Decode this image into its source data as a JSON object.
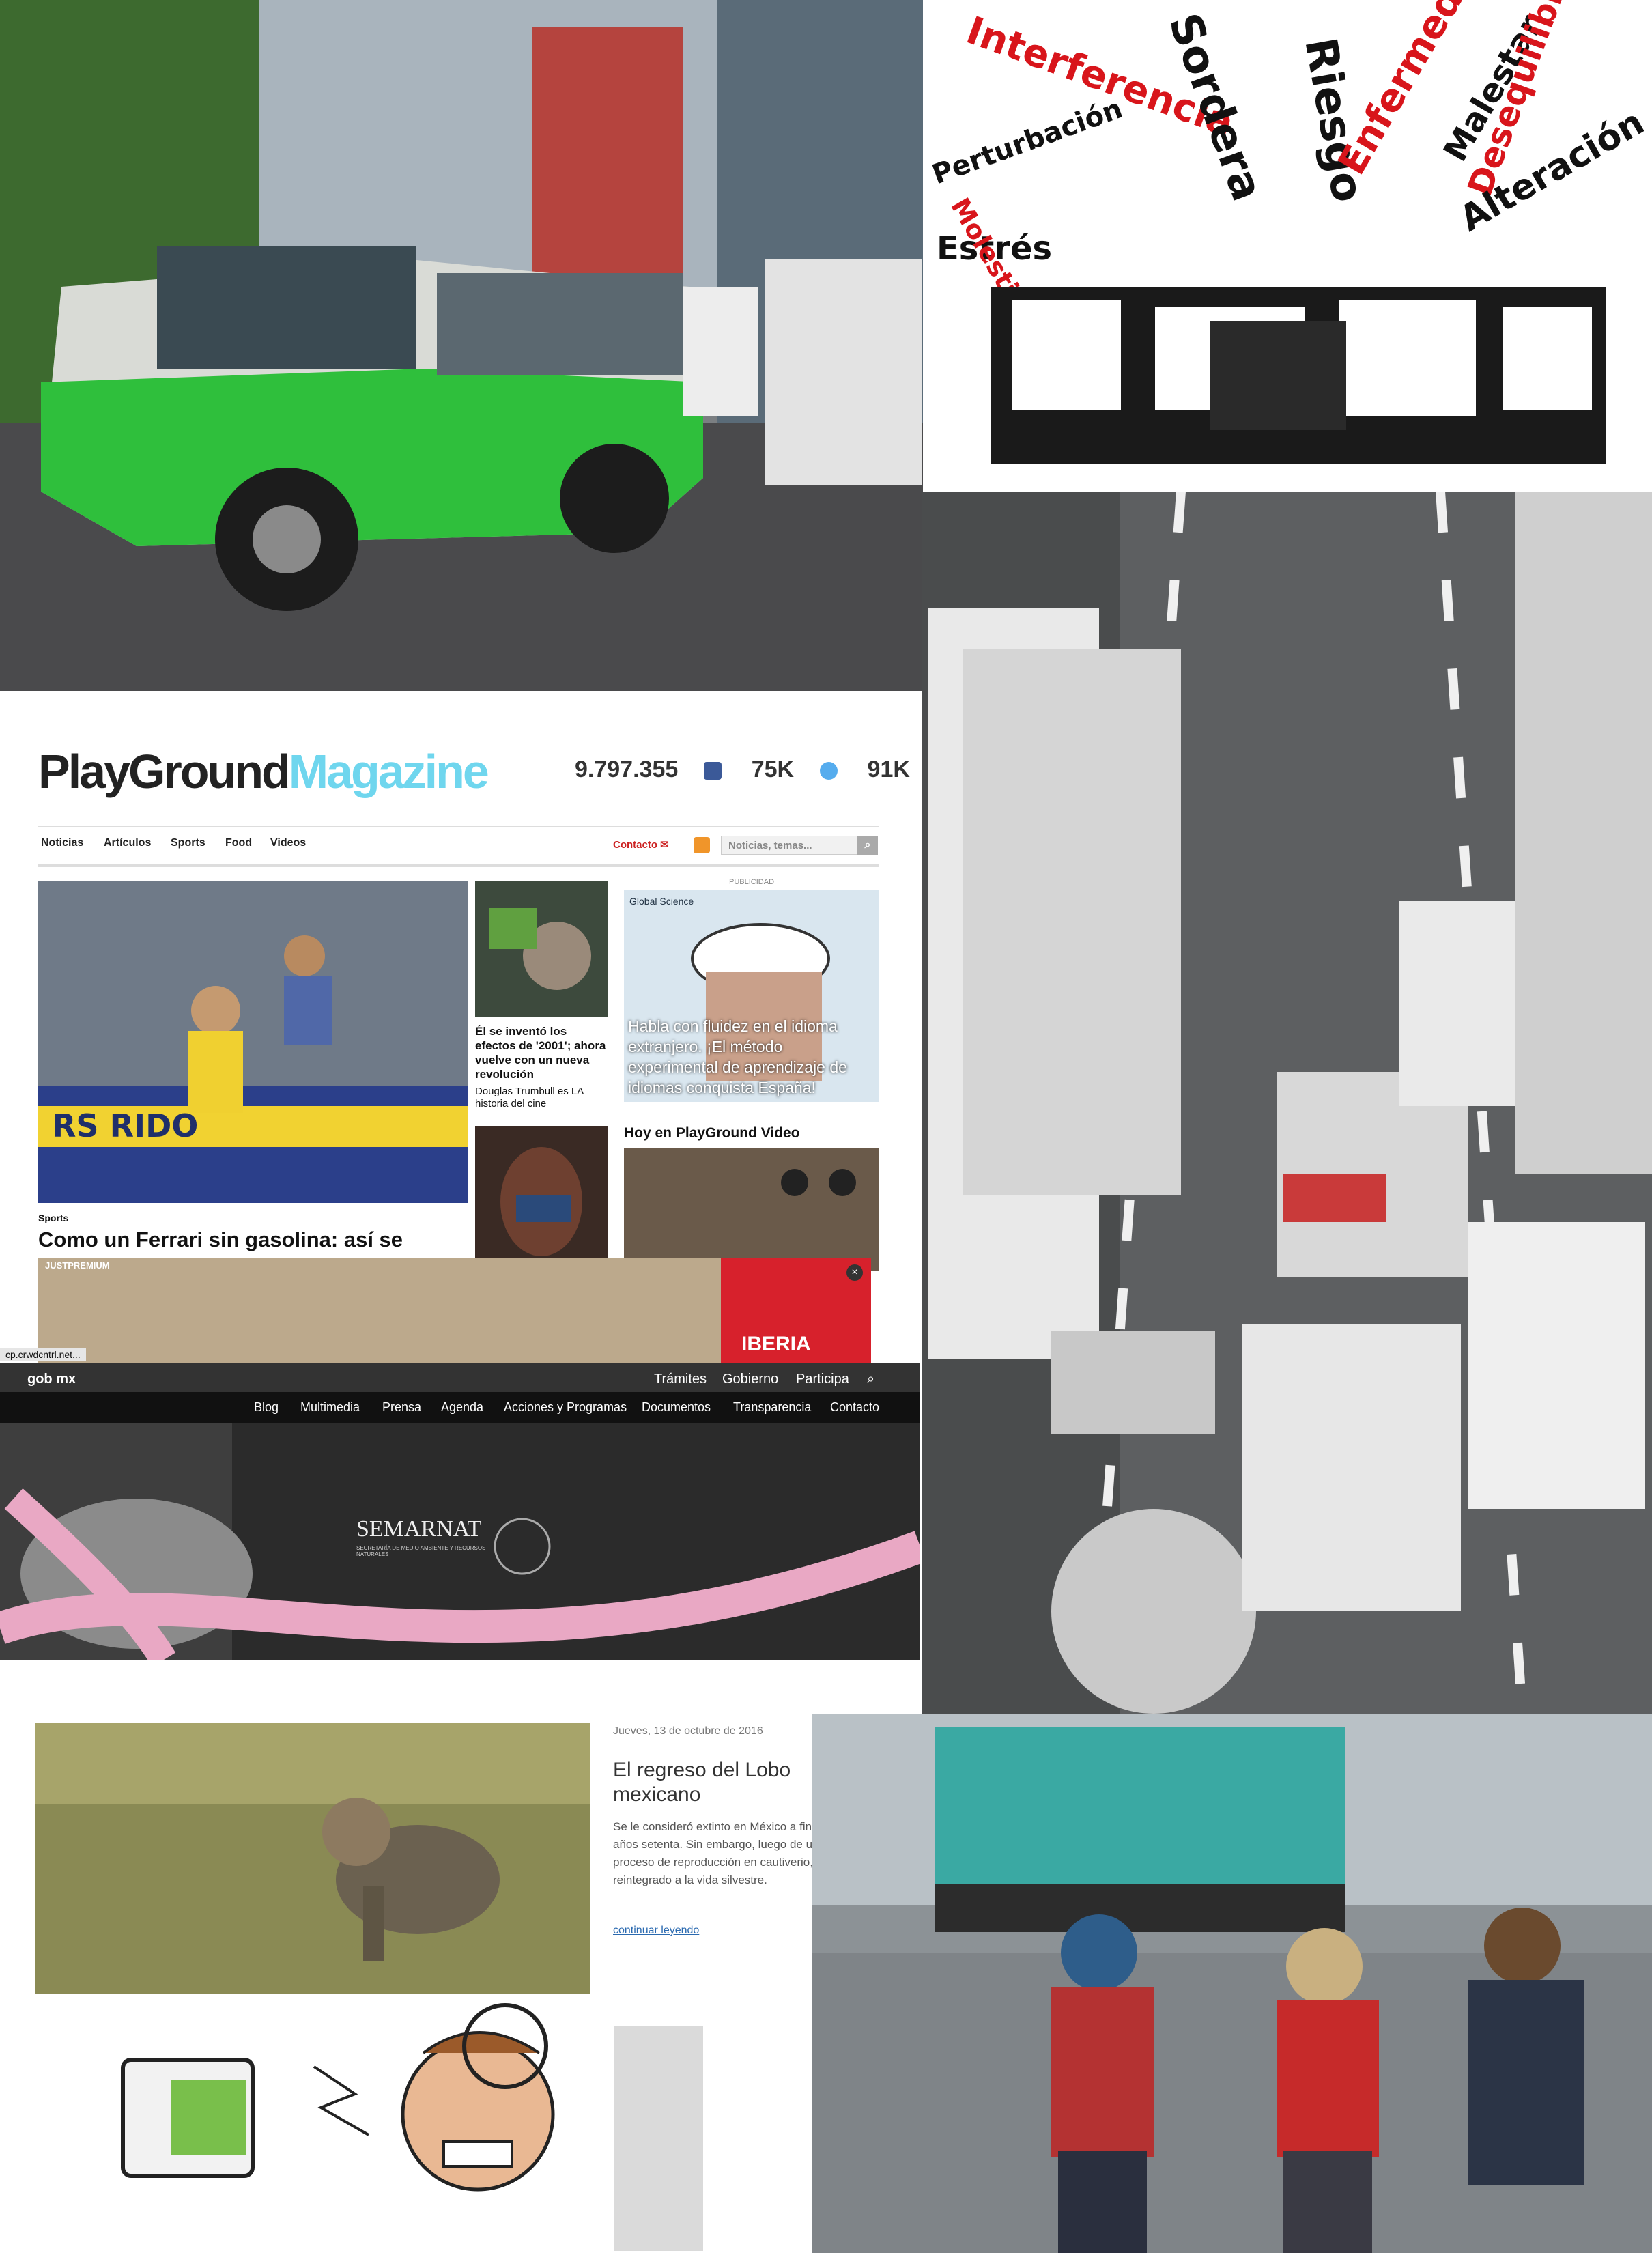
{
  "playground": {
    "logo_a": "PlayGround",
    "logo_b": "Magazine",
    "stats": {
      "facebook": "9.797.355",
      "twitter": "75K",
      "instagram": "91K"
    },
    "nav": [
      "Noticias",
      "Artículos",
      "Sports",
      "Food",
      "Videos"
    ],
    "contact": "Contacto",
    "search_placeholder": "Noticias, temas...",
    "main_category": "Sports",
    "main_title": "Como un Ferrari sin gasolina: así se",
    "side1_title": "Él se inventó los efectos de '2001'; ahora vuelve con un nueva revolución",
    "side1_sub": "Douglas Trumbull es LA historia del cine",
    "ad_label": "PUBLICIDAD",
    "ad_brand": "Global Science",
    "ad_text": "Habla con fluidez en el idioma extranjero. ¡El método experimental de aprendizaje de idiomas conquista España!",
    "video_header": "Hoy en PlayGround Video",
    "banner_label": "JUSTPREMIUM",
    "banner_brand": "IBERIA",
    "status_url": "cp.crwdcntrl.net..."
  },
  "gob": {
    "brand": "gob mx",
    "top_links": [
      "Trámites",
      "Gobierno",
      "Participa"
    ],
    "menu": [
      "Blog",
      "Multimedia",
      "Prensa",
      "Agenda",
      "Acciones y Programas",
      "Documentos",
      "Transparencia",
      "Contacto"
    ],
    "hero_logo": "SEMARNAT",
    "hero_sub": "SECRETARÍA DE MEDIO AMBIENTE Y RECURSOS NATURALES",
    "date": "Jueves, 13 de octubre de 2016",
    "title": "El regreso del Lobo mexicano",
    "body": "Se le consideró extinto en México a finales de los años setenta. Sin embargo, luego de un largo proceso de reproducción en cautiverio, hoy es reintegrado a la vida silvestre.",
    "link": "continuar leyendo"
  },
  "poster_words": [
    "Interferencia",
    "Sordera",
    "Riesgo",
    "Enfermedad",
    "Malestar",
    "Desequilibrio",
    "Alteración",
    "Estrés",
    "Perturbación",
    "Molestia"
  ],
  "colors": {
    "accent_cyan": "#6fd6ee",
    "pg_red": "#c22222",
    "gob_pink": "#e9a8c4",
    "microbus_green": "#2fbf3c"
  }
}
